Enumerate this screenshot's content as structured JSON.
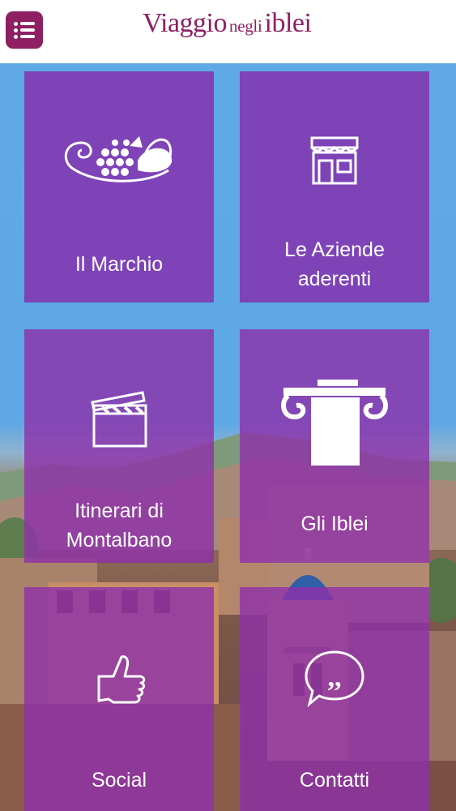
{
  "header": {
    "logo_main": "Viaggio",
    "logo_small": "negli",
    "logo_end": "iblei"
  },
  "icons": {
    "menu": "menu-list-icon",
    "marchio": "cornucopia-grapes-icon",
    "aziende": "storefront-icon",
    "montalbano": "clapperboard-icon",
    "iblei": "ionic-column-capital-icon",
    "social": "thumbs-up-icon",
    "contatti": "speech-bubble-quote-icon"
  },
  "colors": {
    "brand": "#8e1f63",
    "tile": "#8434b2",
    "sky": "#5ea9e6"
  },
  "tiles": [
    {
      "label": "Il Marchio"
    },
    {
      "label_lines": [
        "Le Aziende",
        "aderenti"
      ]
    },
    {
      "label_lines": [
        "Itinerari di",
        "Montalbano"
      ]
    },
    {
      "label": "Gli Iblei"
    },
    {
      "label": "Social"
    },
    {
      "label": "Contatti"
    }
  ]
}
